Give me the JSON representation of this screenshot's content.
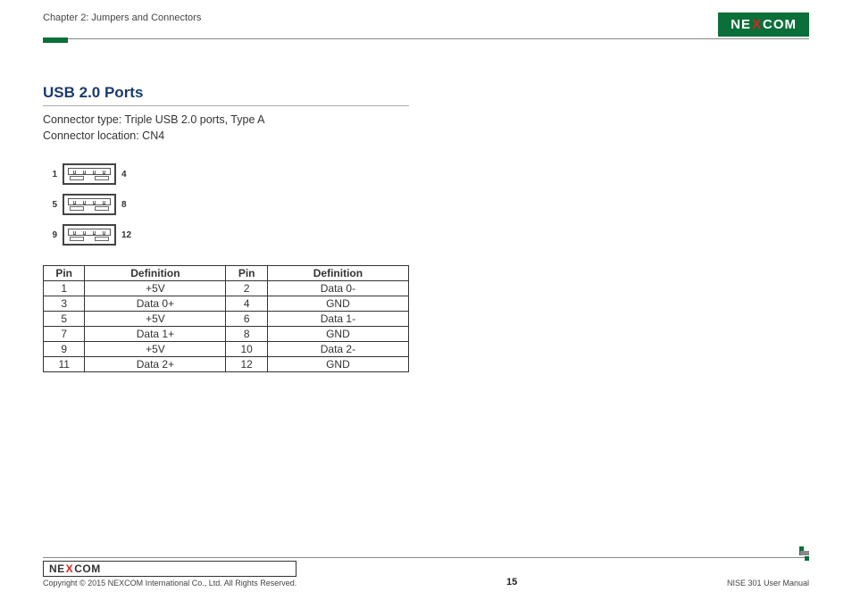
{
  "header": {
    "chapter": "Chapter 2: Jumpers and Connectors",
    "brand_pre": "NE",
    "brand_mid": "X",
    "brand_post": "COM"
  },
  "section": {
    "title": "USB 2.0 Ports",
    "connector_type": "Connector type: Triple USB 2.0 ports, Type A",
    "connector_location": "Connector location: CN4"
  },
  "diagram_labels": {
    "row1_left": "1",
    "row1_right": "4",
    "row2_left": "5",
    "row2_right": "8",
    "row3_left": "9",
    "row3_right": "12"
  },
  "table": {
    "headers": {
      "pin": "Pin",
      "def": "Definition"
    },
    "rows": [
      {
        "p1": "1",
        "d1": "+5V",
        "p2": "2",
        "d2": "Data 0-"
      },
      {
        "p1": "3",
        "d1": "Data 0+",
        "p2": "4",
        "d2": "GND"
      },
      {
        "p1": "5",
        "d1": "+5V",
        "p2": "6",
        "d2": "Data 1-"
      },
      {
        "p1": "7",
        "d1": "Data 1+",
        "p2": "8",
        "d2": "GND"
      },
      {
        "p1": "9",
        "d1": "+5V",
        "p2": "10",
        "d2": "Data 2-"
      },
      {
        "p1": "11",
        "d1": "Data 2+",
        "p2": "12",
        "d2": "GND"
      }
    ]
  },
  "footer": {
    "copyright": "Copyright © 2015 NEXCOM International Co., Ltd. All Rights Reserved.",
    "page_number": "15",
    "doc_title": "NISE 301 User Manual"
  }
}
